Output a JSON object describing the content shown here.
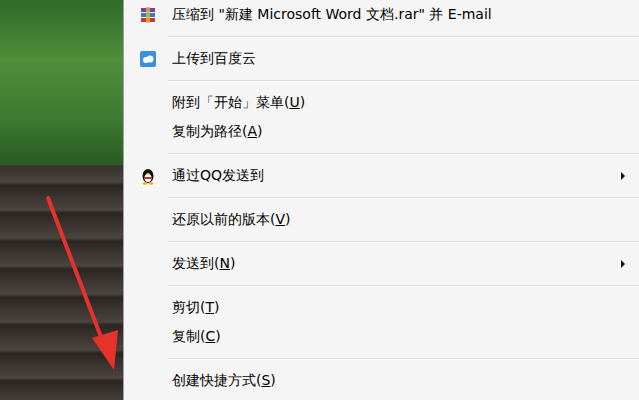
{
  "menu": {
    "items": [
      {
        "kind": "item",
        "label": "压缩到 \"新建 Microsoft Word 文档.rar\" 并 E-mail",
        "accel": "",
        "icon": "archive",
        "submenu": false
      },
      {
        "kind": "separator"
      },
      {
        "kind": "item",
        "label": "上传到百度云",
        "accel": "",
        "icon": "cloud",
        "submenu": false
      },
      {
        "kind": "separator"
      },
      {
        "kind": "item",
        "label": "附到「开始」菜单(U)",
        "accel": "U",
        "icon": "",
        "submenu": false
      },
      {
        "kind": "item",
        "label": "复制为路径(A)",
        "accel": "A",
        "icon": "",
        "submenu": false
      },
      {
        "kind": "separator"
      },
      {
        "kind": "item",
        "label": "通过QQ发送到",
        "accel": "",
        "icon": "penguin",
        "submenu": true
      },
      {
        "kind": "separator"
      },
      {
        "kind": "item",
        "label": "还原以前的版本(V)",
        "accel": "V",
        "icon": "",
        "submenu": false
      },
      {
        "kind": "separator"
      },
      {
        "kind": "item",
        "label": "发送到(N)",
        "accel": "N",
        "icon": "",
        "submenu": true
      },
      {
        "kind": "separator"
      },
      {
        "kind": "item",
        "label": "剪切(T)",
        "accel": "T",
        "icon": "",
        "submenu": false
      },
      {
        "kind": "item",
        "label": "复制(C)",
        "accel": "C",
        "icon": "",
        "submenu": false
      },
      {
        "kind": "separator"
      },
      {
        "kind": "item",
        "label": "创建快捷方式(S)",
        "accel": "S",
        "icon": "",
        "submenu": false
      }
    ]
  }
}
